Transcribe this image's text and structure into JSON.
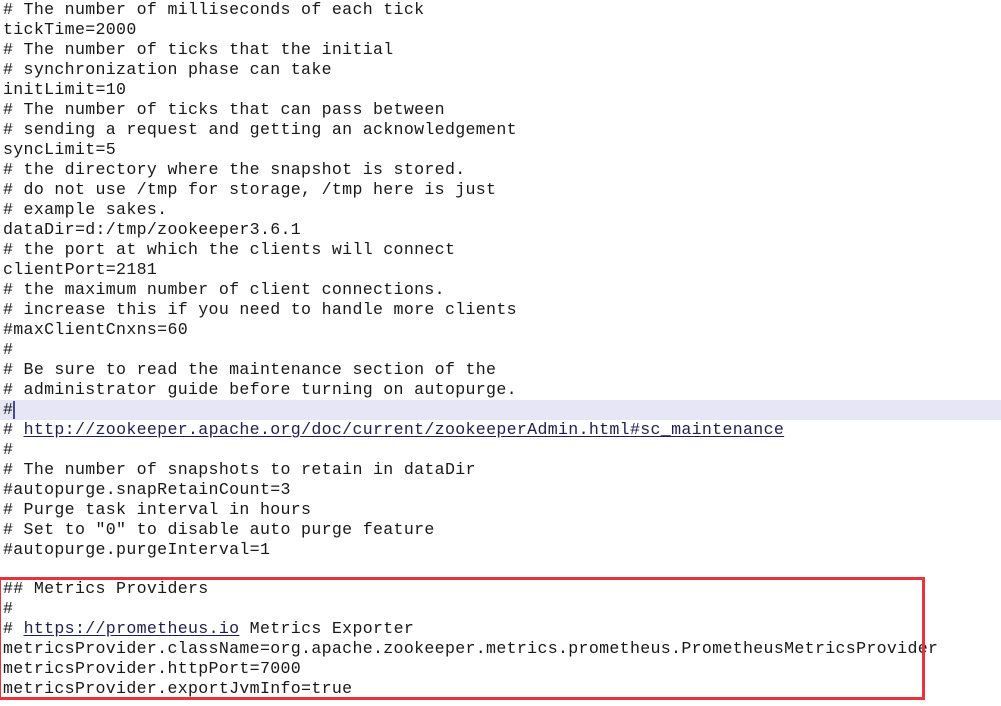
{
  "document": {
    "title": "zoo.cfg",
    "background_color": "#ffffff",
    "text_color": "#181818",
    "current_line_highlight_color": "#e6e6f7",
    "link_color": "#1f1f4f",
    "annotation_box_color": "#e8323c"
  },
  "lines": [
    {
      "text": "# The number of milliseconds of each tick"
    },
    {
      "text": "tickTime=2000"
    },
    {
      "text": "# The number of ticks that the initial"
    },
    {
      "text": "# synchronization phase can take"
    },
    {
      "text": "initLimit=10"
    },
    {
      "text": "# The number of ticks that can pass between"
    },
    {
      "text": "# sending a request and getting an acknowledgement"
    },
    {
      "text": "syncLimit=5"
    },
    {
      "text": "# the directory where the snapshot is stored."
    },
    {
      "text": "# do not use /tmp for storage, /tmp here is just"
    },
    {
      "text": "# example sakes."
    },
    {
      "text": "dataDir=d:/tmp/zookeeper3.6.1"
    },
    {
      "text": "# the port at which the clients will connect"
    },
    {
      "text": "clientPort=2181"
    },
    {
      "text": "# the maximum number of client connections."
    },
    {
      "text": "# increase this if you need to handle more clients"
    },
    {
      "text": "#maxClientCnxns=60"
    },
    {
      "text": "#"
    },
    {
      "text": "# Be sure to read the maintenance section of the"
    },
    {
      "text": "# administrator guide before turning on autopurge."
    },
    {
      "text": "#",
      "current": true,
      "caret": true
    },
    {
      "prefix": "# ",
      "link": "http://zookeeper.apache.org/doc/current/zookeeperAdmin.html#sc_maintenance",
      "suffix": ""
    },
    {
      "text": "#"
    },
    {
      "text": "# The number of snapshots to retain in dataDir"
    },
    {
      "text": "#autopurge.snapRetainCount=3"
    },
    {
      "text": "# Purge task interval in hours"
    },
    {
      "text": "# Set to \"0\" to disable auto purge feature"
    },
    {
      "text": "#autopurge.purgeInterval=1"
    },
    {
      "text": ""
    }
  ],
  "metrics_block": {
    "lines": [
      {
        "text": "## Metrics Providers"
      },
      {
        "text": "#"
      },
      {
        "prefix": "# ",
        "link": "https://prometheus.io",
        "suffix": " Metrics Exporter"
      },
      {
        "text": "metricsProvider.className=org.apache.zookeeper.metrics.prometheus.PrometheusMetricsProvider"
      },
      {
        "text": "metricsProvider.httpPort=7000"
      },
      {
        "text": "metricsProvider.exportJvmInfo=true"
      }
    ]
  }
}
